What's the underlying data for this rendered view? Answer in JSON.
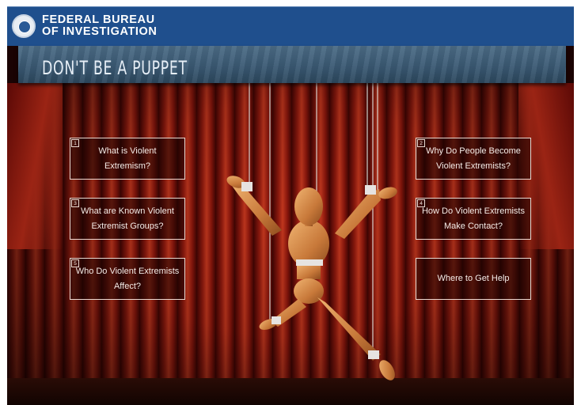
{
  "header": {
    "agency_name": "FEDERAL BUREAU OF INVESTIGATION",
    "seal_icon": "fbi-seal-icon",
    "background_color": "#1f4f8d"
  },
  "banner": {
    "title": "DON'T BE A PUPPET",
    "background_color": "#3b5a74"
  },
  "menu": {
    "left": [
      {
        "number": "1",
        "label": "What is Violent Extremism?"
      },
      {
        "number": "3",
        "label": "What are Known Violent Extremist Groups?"
      },
      {
        "number": "5",
        "label": "Who Do Violent Extremists Affect?"
      }
    ],
    "right": [
      {
        "number": "2",
        "label": "Why Do People Become Violent Extremists?"
      },
      {
        "number": "4",
        "label": "How Do Violent Extremists Make Contact?"
      },
      {
        "number": "",
        "label": "Where to Get Help"
      }
    ]
  },
  "scene": {
    "image": "wooden-marionette-on-stage",
    "curtain_color": "#8f1a0e"
  }
}
